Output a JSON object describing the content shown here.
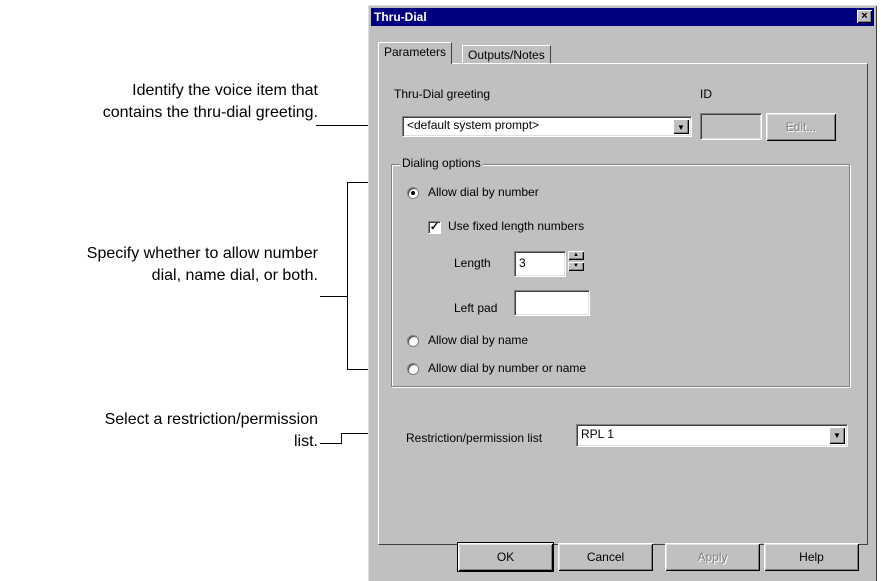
{
  "callouts": {
    "greeting": [
      "Identify the voice item that",
      "contains the thru-dial greeting."
    ],
    "dialing": [
      "Specify whether to allow number",
      "dial, name dial, or both."
    ],
    "restriction": [
      "Select a restriction/permission",
      "list."
    ]
  },
  "dialog": {
    "title": "Thru-Dial",
    "close_glyph": "×",
    "tabs": [
      {
        "label": "Parameters",
        "active": true
      },
      {
        "label": "Outputs/Notes",
        "active": false
      }
    ],
    "greeting": {
      "label": "Thru-Dial greeting",
      "value": "<default system prompt>",
      "id_label": "ID",
      "id_value": "",
      "edit_label": "Edit..."
    },
    "dialing_options": {
      "title": "Dialing options",
      "allow_number": {
        "label": "Allow dial by number",
        "selected": true
      },
      "fixed_length": {
        "label": "Use fixed length numbers",
        "checked": true
      },
      "length": {
        "label": "Length",
        "value": "3"
      },
      "left_pad": {
        "label": "Left pad",
        "value": ""
      },
      "allow_name": {
        "label": "Allow dial by name",
        "selected": false
      },
      "allow_both": {
        "label": "Allow dial by number or name",
        "selected": false
      }
    },
    "restriction": {
      "label": "Restriction/permission list",
      "value": "RPL 1"
    },
    "buttons": {
      "ok": "OK",
      "cancel": "Cancel",
      "apply": "Apply",
      "help": "Help"
    }
  },
  "icons": {
    "dropdown_arrow": "▼",
    "check_mark": "✓",
    "spin_up": "▲",
    "spin_down": "▼"
  }
}
